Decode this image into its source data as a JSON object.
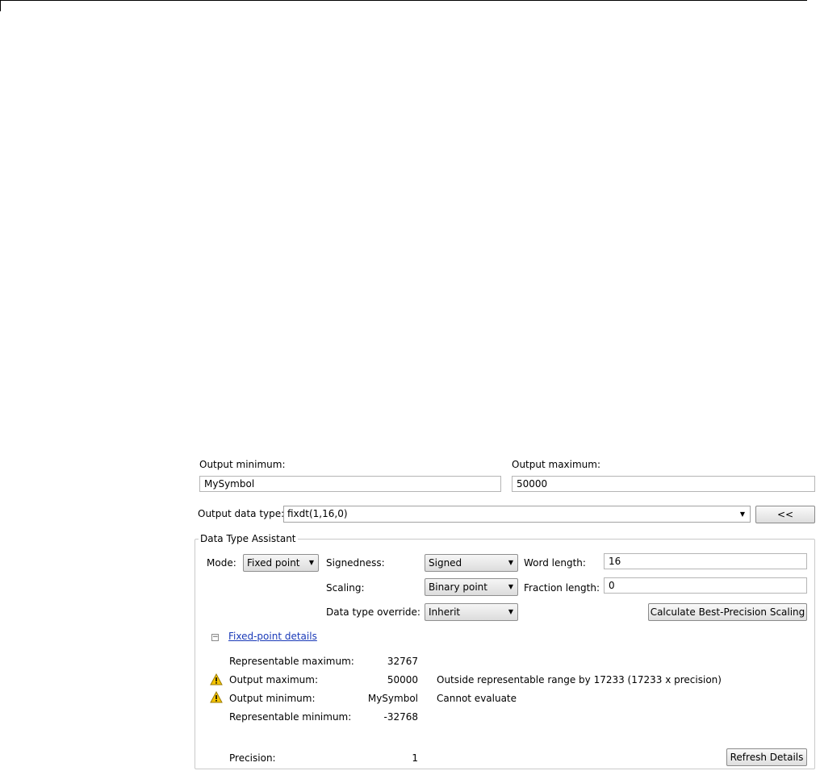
{
  "output_minimum": {
    "label": "Output minimum:",
    "value": "MySymbol"
  },
  "output_maximum": {
    "label": "Output maximum:",
    "value": "50000"
  },
  "output_data_type": {
    "label": "Output data type:",
    "value": "fixdt(1,16,0)",
    "toggle_button": "<<"
  },
  "assistant": {
    "title": "Data Type Assistant",
    "mode_label": "Mode:",
    "mode_value": "Fixed point",
    "signedness_label": "Signedness:",
    "signedness_value": "Signed",
    "word_length_label": "Word length:",
    "word_length_value": "16",
    "scaling_label": "Scaling:",
    "scaling_value": "Binary point",
    "fraction_length_label": "Fraction length:",
    "fraction_length_value": "0",
    "override_label": "Data type override:",
    "override_value": "Inherit",
    "calc_button": "Calculate Best-Precision Scaling"
  },
  "details": {
    "link": "Fixed-point details",
    "rows": [
      {
        "label": "Representable maximum:",
        "value": "32767",
        "message": ""
      },
      {
        "label": "Output maximum:",
        "value": "50000",
        "message": "Outside representable range by 17233 (17233 x precision)"
      },
      {
        "label": "Output minimum:",
        "value": "MySymbol",
        "message": "Cannot evaluate"
      },
      {
        "label": "Representable minimum:",
        "value": "-32768",
        "message": ""
      }
    ],
    "precision_label": "Precision:",
    "precision_value": "1",
    "refresh_button": "Refresh Details"
  },
  "icons": {
    "warning": "warning-icon",
    "expander": "collapse-icon",
    "dropdown": "chevron-down-icon"
  },
  "colors": {
    "link": "#1a3ab8",
    "warning_fill": "#f5c400"
  }
}
